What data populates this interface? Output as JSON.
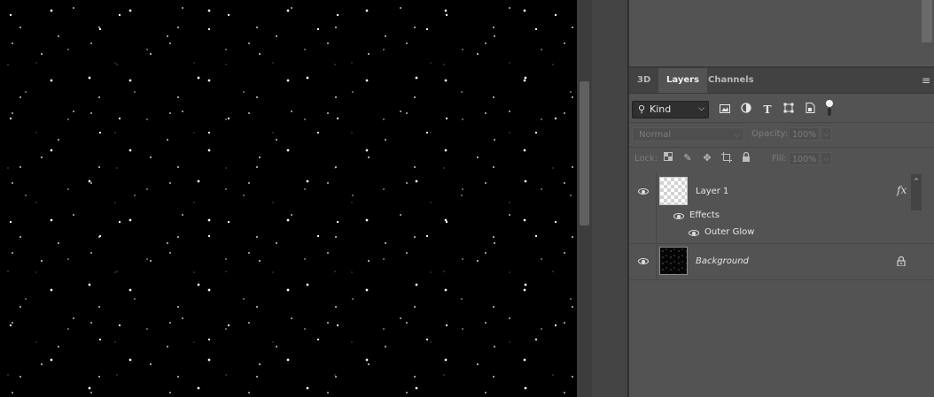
{
  "tabs": [
    {
      "label": "3D",
      "active": false
    },
    {
      "label": "Layers",
      "active": true
    },
    {
      "label": "Channels",
      "active": false
    }
  ],
  "filter": {
    "kind_label": "Kind",
    "icons": [
      "image-filter-icon",
      "adjustment-filter-icon",
      "type-filter-icon",
      "shape-filter-icon",
      "smart-object-filter-icon",
      "filter-toggle-icon"
    ]
  },
  "blend": {
    "mode": "Normal",
    "opacity_label": "Opacity:",
    "opacity_value": "100%"
  },
  "lock": {
    "label": "Lock:",
    "icons": [
      "lock-transparent-pixels-icon",
      "lock-image-pixels-icon",
      "lock-position-icon",
      "lock-artboard-icon",
      "lock-all-icon"
    ],
    "fill_label": "Fill:",
    "fill_value": "100%"
  },
  "layers": [
    {
      "name": "Layer 1",
      "visible": true,
      "thumbnail": "transparent",
      "fx_badge": "fx",
      "effects_label": "Effects",
      "effects": [
        "Outer Glow"
      ]
    },
    {
      "name": "Background",
      "visible": true,
      "thumbnail": "starfield",
      "locked": true
    }
  ],
  "colors": {
    "panel_bg": "#535353",
    "tabbar_bg": "#424242",
    "canvas_bg": "#000000",
    "text": "#e6e6e6"
  }
}
